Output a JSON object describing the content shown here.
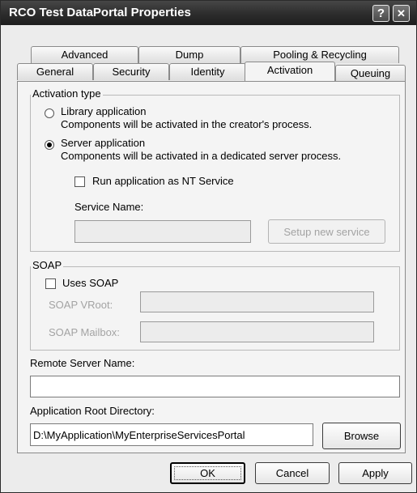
{
  "window": {
    "title": "RCO Test DataPortal Properties",
    "help_glyph": "?",
    "close_glyph": "✕"
  },
  "tabs": {
    "back_row": [
      "Advanced",
      "Dump",
      "Pooling & Recycling"
    ],
    "front_row": [
      "General",
      "Security",
      "Identity",
      "Activation",
      "Queuing"
    ],
    "active": "Activation"
  },
  "activation_type": {
    "legend": "Activation type",
    "library_label": "Library application",
    "library_desc": "Components will be activated in the creator's process.",
    "server_label": "Server application",
    "server_desc": "Components will be activated in a dedicated server process.",
    "selected": "server",
    "nt_service_label": "Run application as NT Service",
    "nt_service_checked": false,
    "service_name_label": "Service Name:",
    "service_name_value": "",
    "setup_button": "Setup new service"
  },
  "soap": {
    "legend": "SOAP",
    "uses_soap_label": "Uses SOAP",
    "uses_soap_checked": false,
    "vroot_label": "SOAP VRoot:",
    "vroot_value": "",
    "mailbox_label": "SOAP Mailbox:",
    "mailbox_value": ""
  },
  "remote_server": {
    "label": "Remote Server Name:",
    "value": ""
  },
  "app_root": {
    "label": "Application Root Directory:",
    "value": "D:\\MyApplication\\MyEnterpriseServicesPortal",
    "browse_button": "Browse"
  },
  "footer": {
    "ok": "OK",
    "cancel": "Cancel",
    "apply": "Apply"
  }
}
